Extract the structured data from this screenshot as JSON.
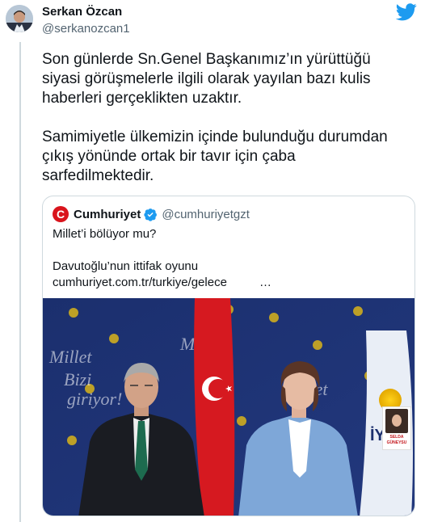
{
  "author": {
    "name": "Serkan Özcan",
    "handle": "@serkanozcan1"
  },
  "tweet": {
    "paragraph1": "Son günlerde Sn.Genel Başkanımız’ın yürüttüğü\nsiyasi görüşmelerle ilgili olarak yayılan bazı kulis\nhaberleri gerçeklikten uzaktır.",
    "paragraph2": "Samimiyetle ülkemizin içinde bulunduğu durumdan\nçıkış yönünde ortak bir tavır için çaba\nsarfedilmektedir."
  },
  "quote": {
    "avatar_letter": "C",
    "name": "Cumhuriyet",
    "handle": "@cumhuriyetgzt",
    "line1": "Millet’i bölüyor mu?",
    "line2": "Davutoğlu’nun ittifak oyunu",
    "link": "cumhuriyet.com.tr/turkiye/gelece",
    "ellipsis": "…",
    "photo_badge": "SELDA GÜNEYSU"
  },
  "colors": {
    "brand_blue": "#1d9bf0",
    "cumhuriyet_red": "#d9141c",
    "text_primary": "#0f1419",
    "text_secondary": "#536471",
    "border": "#cfd9de"
  },
  "icons": {
    "logo": "twitter-bird-icon",
    "verified": "verified-badge-icon"
  }
}
